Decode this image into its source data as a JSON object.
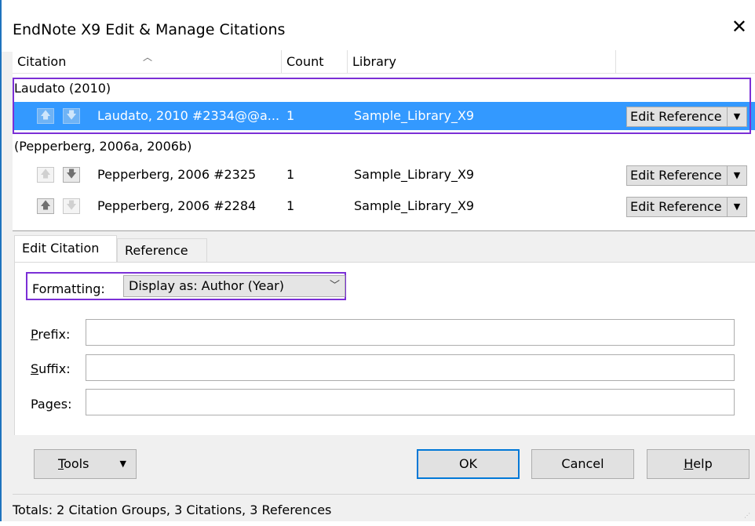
{
  "window": {
    "title": "EndNote X9 Edit & Manage Citations"
  },
  "grid": {
    "columns": [
      "Citation",
      "Count",
      "Library"
    ],
    "groups": [
      {
        "label": "Laudato (2010)",
        "rows": [
          {
            "citation": "Laudato, 2010 #2334@@a...",
            "count": "1",
            "library": "Sample_Library_X9",
            "selected": true,
            "up_enabled": false,
            "down_enabled": false
          }
        ]
      },
      {
        "label": "(Pepperberg, 2006a, 2006b)",
        "rows": [
          {
            "citation": "Pepperberg, 2006 #2325",
            "count": "1",
            "library": "Sample_Library_X9",
            "selected": false,
            "up_enabled": false,
            "down_enabled": true
          },
          {
            "citation": "Pepperberg, 2006 #2284",
            "count": "1",
            "library": "Sample_Library_X9",
            "selected": false,
            "up_enabled": true,
            "down_enabled": false
          }
        ]
      }
    ],
    "edit_reference_label": "Edit Reference"
  },
  "tabs": [
    "Edit Citation",
    "Reference"
  ],
  "active_tab": "Edit Citation",
  "form": {
    "formatting_label": "Formatting:",
    "formatting_value": "Display as: Author (Year)",
    "prefix_label_u": "P",
    "prefix_label_rest": "refix:",
    "prefix_value": "",
    "suffix_label_u": "S",
    "suffix_label_rest": "uffix:",
    "suffix_value": "",
    "pages_label_pre": "Pa",
    "pages_label_u": "g",
    "pages_label_rest": "es:",
    "pages_value": ""
  },
  "buttons": {
    "tools_u": "T",
    "tools_rest": "ools",
    "ok": "OK",
    "cancel": "Cancel",
    "help_u": "H",
    "help_rest": "elp"
  },
  "status": "Totals: 2 Citation Groups, 3 Citations, 3 References",
  "colors": {
    "selection": "#3399ff",
    "highlight": "#7b2fd6",
    "default_button_border": "#0078d7"
  }
}
